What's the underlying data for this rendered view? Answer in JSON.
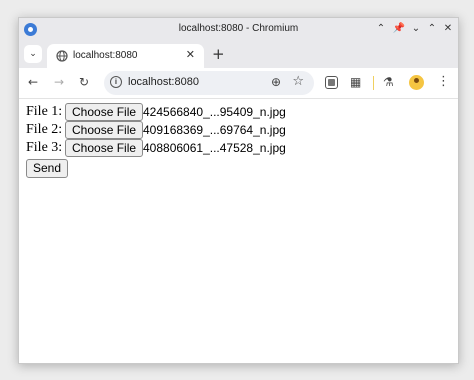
{
  "window": {
    "title": "localhost:8080 - Chromium"
  },
  "tab": {
    "title": "localhost:8080"
  },
  "omnibox": {
    "url": "localhost:8080"
  },
  "icons": {
    "app": "chromium-icon",
    "pin": "pin-icon",
    "minimize": "chevron-down-icon",
    "maximize": "chevron-up-icon",
    "close": "close-icon",
    "back": "back-arrow-icon",
    "forward": "forward-arrow-icon",
    "reload": "reload-icon"
  },
  "form": {
    "rows": [
      {
        "label": "File 1:",
        "button": "Choose File",
        "file": "424566840_...95409_n.jpg"
      },
      {
        "label": "File 2:",
        "button": "Choose File",
        "file": "409168369_...69764_n.jpg"
      },
      {
        "label": "File 3:",
        "button": "Choose File",
        "file": "408806061_...47528_n.jpg"
      }
    ],
    "send_label": "Send"
  }
}
